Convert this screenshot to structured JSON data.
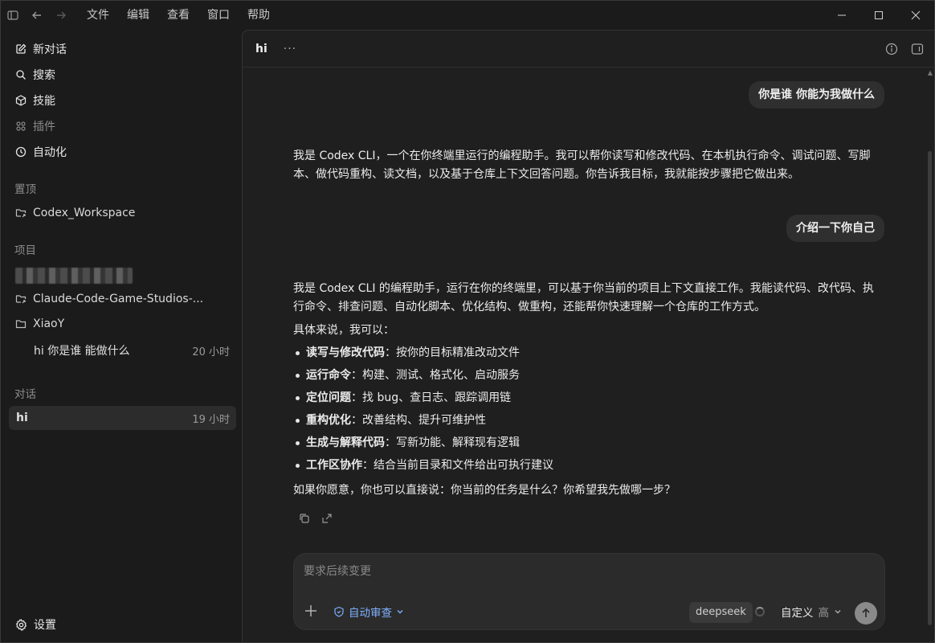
{
  "menu": [
    "文件",
    "编辑",
    "查看",
    "窗口",
    "帮助"
  ],
  "sidebar": {
    "nav": [
      {
        "label": "新对话",
        "icon": "edit-icon"
      },
      {
        "label": "搜索",
        "icon": "search-icon"
      },
      {
        "label": "技能",
        "icon": "cube-icon"
      },
      {
        "label": "插件",
        "icon": "grid-icon"
      },
      {
        "label": "自动化",
        "icon": "clock-icon"
      }
    ],
    "pinned_label": "置顶",
    "pinned": [
      {
        "label": "Codex_Workspace",
        "icon": "folder-link-icon"
      }
    ],
    "projects_label": "项目",
    "projects": [
      {
        "label": "Claude-Code-Game-Studios-...",
        "icon": "folder-link-icon"
      },
      {
        "label": "XiaoY",
        "icon": "folder-icon"
      }
    ],
    "project_thread": {
      "label": "hi 你是谁 能做什么",
      "time": "20 小时"
    },
    "chats_label": "对话",
    "chat": {
      "label": "hi",
      "time": "19 小时"
    },
    "settings": "设置"
  },
  "main": {
    "title": "hi",
    "more": "···",
    "messages": {
      "user1": "你是谁  你能为我做什么",
      "reply1": "我是 Codex CLI，一个在你终端里运行的编程助手。我可以帮你读写和修改代码、在本机执行命令、调试问题、写脚本、做代码重构、读文档，以及基于仓库上下文回答问题。你告诉我目标，我就能按步骤把它做出来。",
      "user2": "介绍一下你自己",
      "reply2_intro": "我是 Codex CLI 的编程助手，运行在你的终端里，可以基于你当前的项目上下文直接工作。我能读代码、改代码、执行命令、排查问题、自动化脚本、优化结构、做重构，还能帮你快速理解一个仓库的工作方式。",
      "reply2_lead": "具体来说，我可以：",
      "bullets": [
        {
          "b": "读写与修改代码",
          "t": "：按你的目标精准改动文件"
        },
        {
          "b": "运行命令",
          "t": "：构建、测试、格式化、启动服务"
        },
        {
          "b": "定位问题",
          "t": "：找 bug、查日志、跟踪调用链"
        },
        {
          "b": "重构优化",
          "t": "：改善结构、提升可维护性"
        },
        {
          "b": "生成与解释代码",
          "t": "：写新功能、解释现有逻辑"
        },
        {
          "b": "工作区协作",
          "t": "：结合当前目录和文件给出可执行建议"
        }
      ],
      "reply2_outro": "如果你愿意，你也可以直接说：你当前的任务是什么？你希望我先做哪一步？"
    },
    "composer": {
      "placeholder": "要求后续变更",
      "review": "自动审查",
      "model": "deepseek",
      "custom": "自定义",
      "level": "高"
    }
  }
}
